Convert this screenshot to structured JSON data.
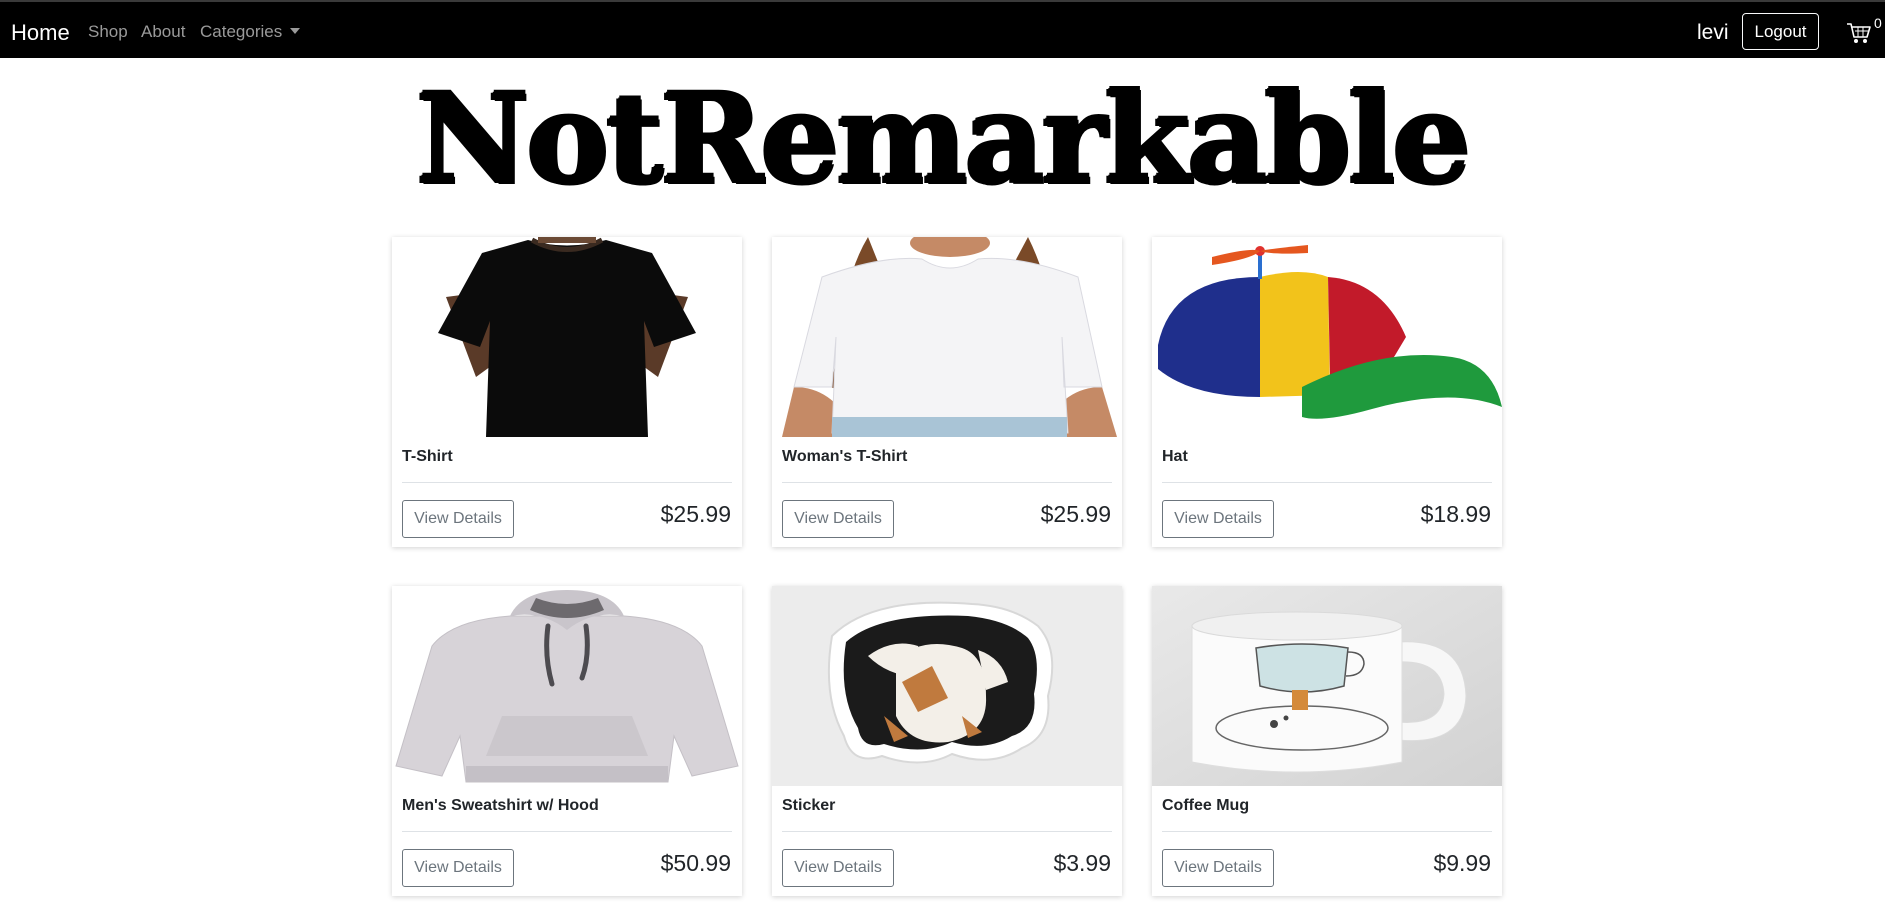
{
  "navbar": {
    "brand": "Home",
    "links": [
      "Shop",
      "About",
      "Categories"
    ],
    "username": "levi",
    "logout_label": "Logout",
    "cart_icon": "cart-icon",
    "cart_count": "0"
  },
  "logo_text": "NotRemarkable",
  "products": [
    {
      "title": "T-Shirt",
      "button": "View Details",
      "price": "$25.99"
    },
    {
      "title": "Woman's T-Shirt",
      "button": "View Details",
      "price": "$25.99"
    },
    {
      "title": "Hat",
      "button": "View Details",
      "price": "$18.99"
    },
    {
      "title": "Men's Sweatshirt w/ Hood",
      "button": "View Details",
      "price": "$50.99"
    },
    {
      "title": "Sticker",
      "button": "View Details",
      "price": "$3.99"
    },
    {
      "title": "Coffee Mug",
      "button": "View Details",
      "price": "$9.99"
    }
  ],
  "colors": {
    "navbar_bg": "#000000",
    "muted_link": "#9a9a9a",
    "button_border": "#6c757d"
  }
}
